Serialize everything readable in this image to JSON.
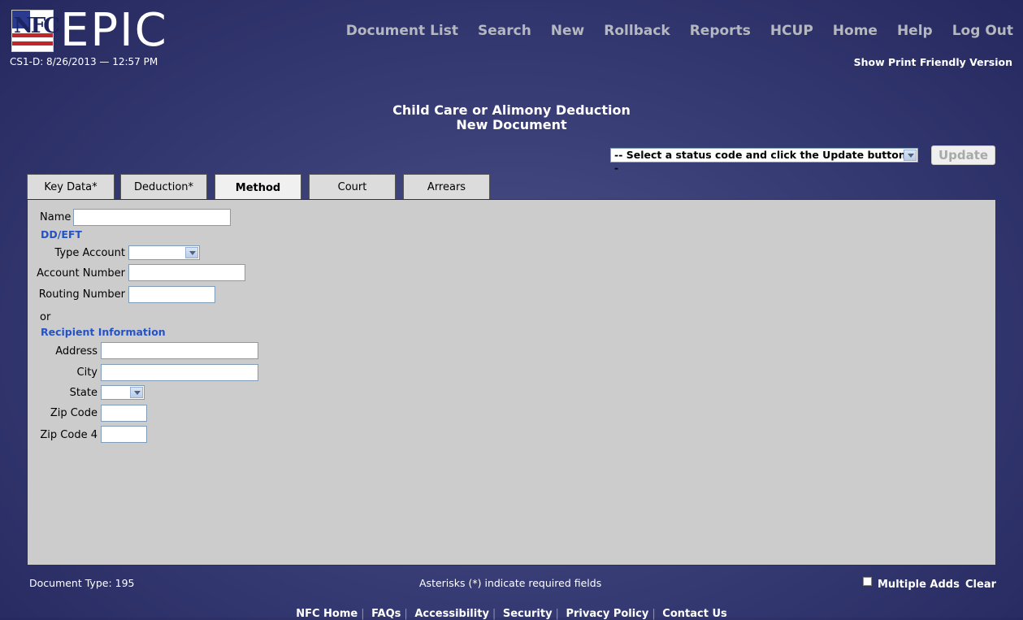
{
  "header": {
    "logo_text": "EPIC",
    "logo_mark_text": "NFC",
    "session_info": "CS1-D: 8/26/2013 — 12:57 PM",
    "print_link": "Show Print Friendly Version",
    "nav": [
      "Document List",
      "Search",
      "New",
      "Rollback",
      "Reports",
      "HCUP",
      "Home",
      "Help",
      "Log Out"
    ]
  },
  "title": {
    "line1": "Child Care or Alimony Deduction",
    "line2": "New Document"
  },
  "status": {
    "selected": "-- Select a status code and click the Update button --",
    "update_label": "Update"
  },
  "tabs": [
    {
      "label": "Key Data*",
      "active": false
    },
    {
      "label": "Deduction*",
      "active": false
    },
    {
      "label": "Method",
      "active": true
    },
    {
      "label": "Court",
      "active": false
    },
    {
      "label": "Arrears",
      "active": false
    }
  ],
  "form": {
    "name_label": "Name",
    "ddeft_heading": "DD/EFT",
    "type_account_label": "Type Account",
    "account_number_label": "Account Number",
    "routing_number_label": "Routing Number",
    "or_text": "or",
    "recipient_heading": "Recipient Information",
    "address_label": "Address",
    "city_label": "City",
    "state_label": "State",
    "zip_label": "Zip Code",
    "zip4_label": "Zip Code 4"
  },
  "footer": {
    "document_type": "Document Type: 195",
    "required_note": "Asterisks (*) indicate required fields",
    "multiple_adds": "Multiple Adds",
    "clear": "Clear",
    "links": [
      "NFC Home",
      "FAQs",
      "Accessibility",
      "Security",
      "Privacy Policy",
      "Contact Us"
    ]
  }
}
